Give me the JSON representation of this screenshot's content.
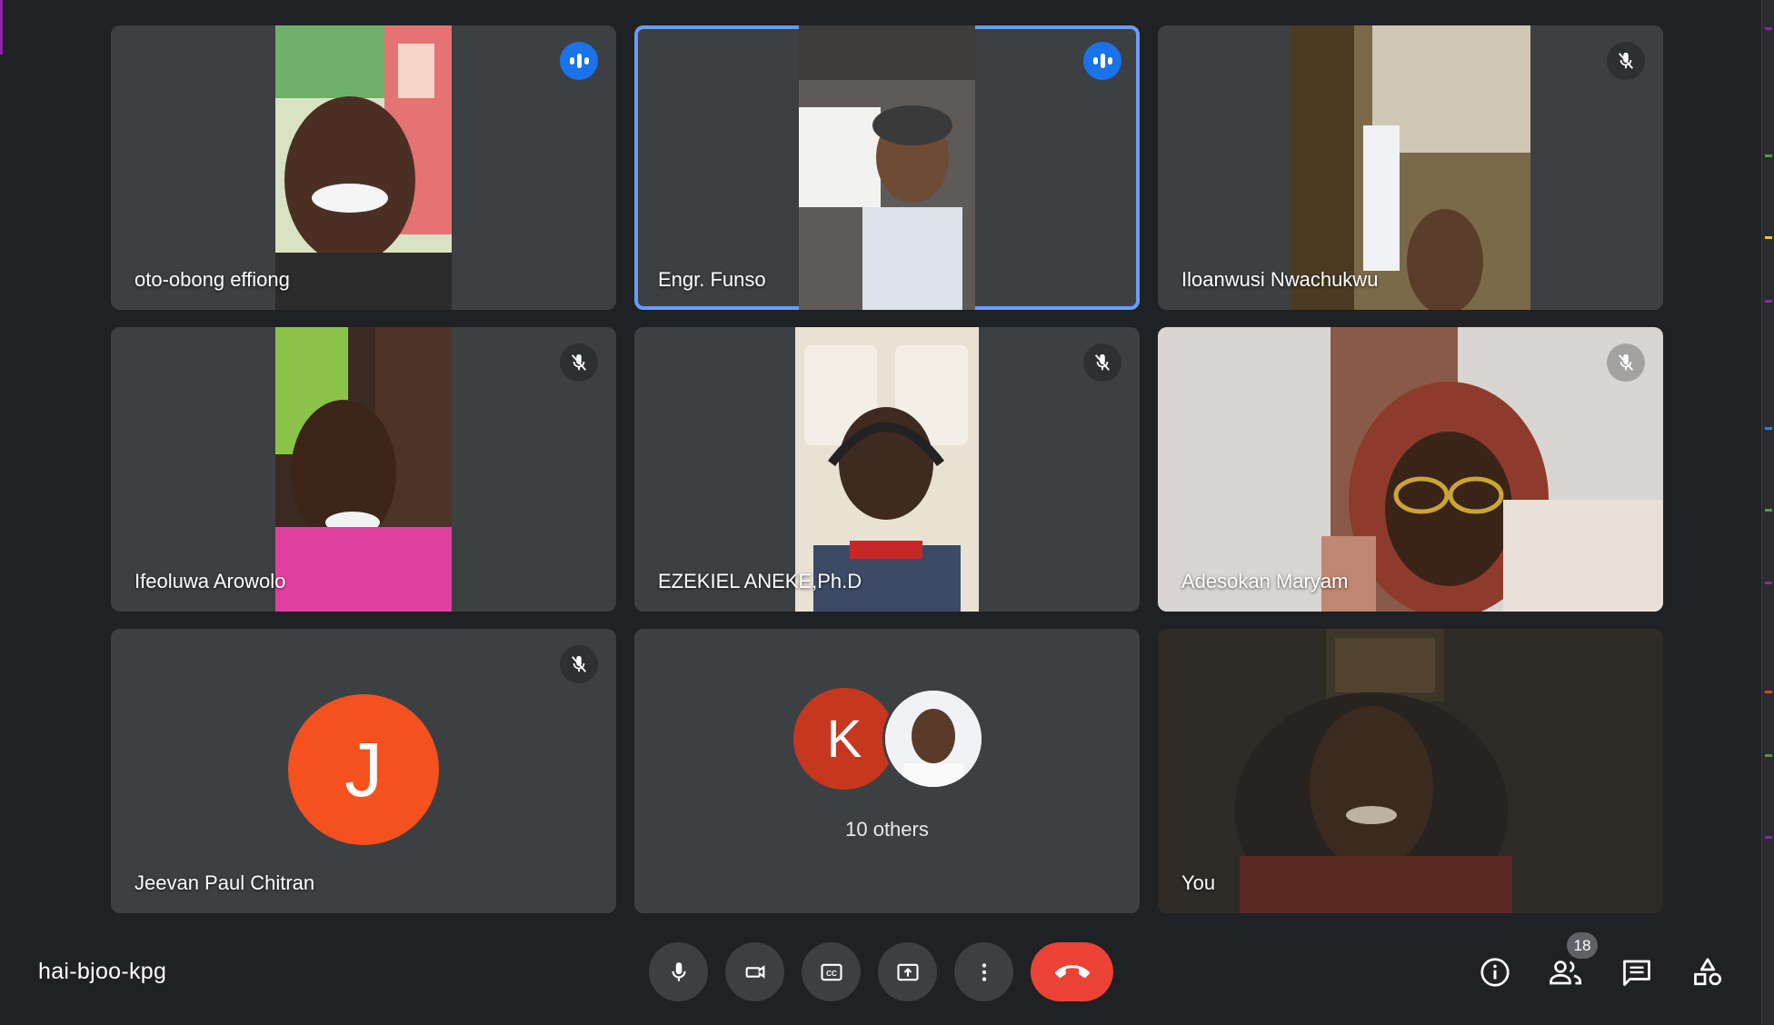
{
  "meeting": {
    "code": "hai-bjoo-kpg"
  },
  "tiles": [
    {
      "name": "oto-obong effiong",
      "status": "speaking"
    },
    {
      "name": "Engr. Funso",
      "status": "speaking"
    },
    {
      "name": "Iloanwusi Nwachukwu",
      "status": "muted"
    },
    {
      "name": "Ifeoluwa Arowolo",
      "status": "muted"
    },
    {
      "name": "EZEKIEL ANEKE,Ph.D",
      "status": "muted"
    },
    {
      "name": "Adesokan Maryam",
      "status": "muted"
    },
    {
      "name": "Jeevan Paul Chitran",
      "status": "muted",
      "avatar_letter": "J",
      "avatar_color": "#f4511e"
    },
    {
      "others_label": "10 others",
      "avatar_letter": "K",
      "avatar_color": "#c5381f"
    },
    {
      "name": "You"
    }
  ],
  "controls": {
    "mic": "microphone-icon",
    "camera": "camera-icon",
    "captions": "closed-captions-icon",
    "present": "present-screen-icon",
    "more": "more-options-icon",
    "hangup": "hang-up-icon",
    "hangup_color": "#ea4335"
  },
  "side": {
    "info": "info-icon",
    "people": "people-icon",
    "people_count": "18",
    "chat": "chat-icon",
    "activities": "activities-icon"
  },
  "colors": {
    "active_speaker_outline": "#669df6",
    "speaking_badge": "#1a73e8"
  }
}
